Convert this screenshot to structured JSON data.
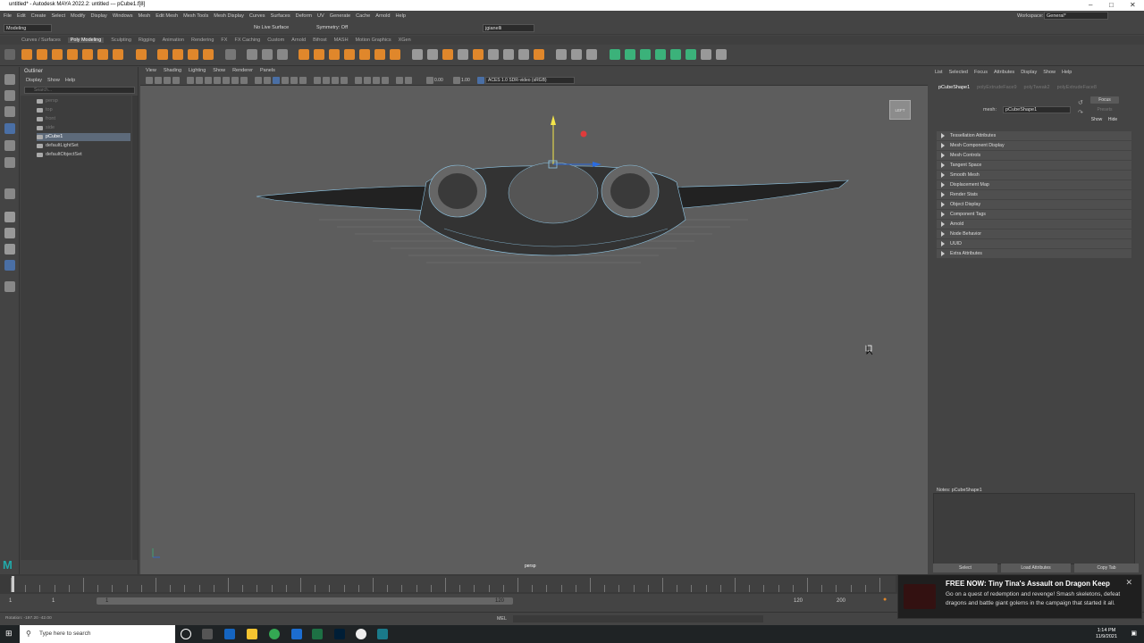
{
  "window": {
    "title": "untitled* - Autodesk MAYA 2022.2: untitled   ---   pCube1.f[8]"
  },
  "menubar": [
    "File",
    "Edit",
    "Create",
    "Select",
    "Modify",
    "Display",
    "Windows",
    "Mesh",
    "Edit Mesh",
    "Mesh Tools",
    "Mesh Display",
    "Curves",
    "Surfaces",
    "Deform",
    "UV",
    "Generate",
    "Cache",
    "Arnold",
    "Help"
  ],
  "workspace": {
    "label": "Workspace:",
    "value": "General*"
  },
  "statusline": {
    "mode": "Modeling",
    "live_surface": "No Live Surface",
    "symmetry": "Symmetry: Off",
    "user": "jgianelli"
  },
  "shelf_tabs": [
    "Curves / Surfaces",
    "Poly Modeling",
    "Sculpting",
    "Rigging",
    "Animation",
    "Rendering",
    "FX",
    "FX Caching",
    "Custom",
    "Arnold",
    "Bifrost",
    "MASH",
    "Motion Graphics",
    "XGen"
  ],
  "shelf_active": "Poly Modeling",
  "outliner": {
    "title": "Outliner",
    "menu": [
      "Display",
      "Show",
      "Help"
    ],
    "search_placeholder": "Search...",
    "items": [
      {
        "label": "persp",
        "dim": true
      },
      {
        "label": "top",
        "dim": true
      },
      {
        "label": "front",
        "dim": true
      },
      {
        "label": "side",
        "dim": true
      },
      {
        "label": "pCube1",
        "selected": true
      },
      {
        "label": "defaultLightSet"
      },
      {
        "label": "defaultObjectSet"
      }
    ]
  },
  "viewport": {
    "menu": [
      "View",
      "Shading",
      "Lighting",
      "Show",
      "Renderer",
      "Panels"
    ],
    "exposure": "0.00",
    "gamma": "1.00",
    "colorspace": "ACES 1.0 SDR-video (sRGB)",
    "camera": "persp",
    "viewcube": "LEFT"
  },
  "attribute_editor": {
    "menu": [
      "List",
      "Selected",
      "Focus",
      "Attributes",
      "Display",
      "Show",
      "Help"
    ],
    "tabs": [
      "pCubeShape1",
      "polyExtrudeFace9",
      "polyTweak2",
      "polyExtrudeFace8"
    ],
    "mesh_label": "mesh:",
    "mesh_value": "pCubeShape1",
    "focus": "Focus",
    "presets": "Presets",
    "show": "Show",
    "hide": "Hide",
    "sections": [
      "Tessellation Attributes",
      "Mesh Component Display",
      "Mesh Controls",
      "Tangent Space",
      "Smooth Mesh",
      "Displacement Map",
      "Render Stats",
      "Object Display",
      "Component Tags",
      "Arnold",
      "Node Behavior",
      "UUID",
      "Extra Attributes"
    ],
    "notes": "Notes: pCubeShape1",
    "buttons": [
      "Select",
      "Load Attributes",
      "Copy Tab"
    ]
  },
  "timeline": {
    "start": "1",
    "end": "120",
    "range_start": "1",
    "range_end": "120",
    "anim_end": "120",
    "anim_max": "200",
    "current": "1"
  },
  "cmdline": {
    "feedback": "Rotation: -197.20   -42.00",
    "lang": "MEL"
  },
  "taskbar": {
    "search": "Type here to search",
    "time": "1:14 PM",
    "date": "11/9/2021"
  },
  "toast": {
    "title": "FREE NOW: Tiny Tina's Assault on Dragon Keep",
    "body": "Go on a quest of redemption and revenge! Smash skeletons, defeat dragons and battle giant golems in the campaign that started it all."
  },
  "colors": {
    "accent": "#e0872b",
    "selection": "#5d6a7a",
    "maya_teal": "#2aa"
  }
}
